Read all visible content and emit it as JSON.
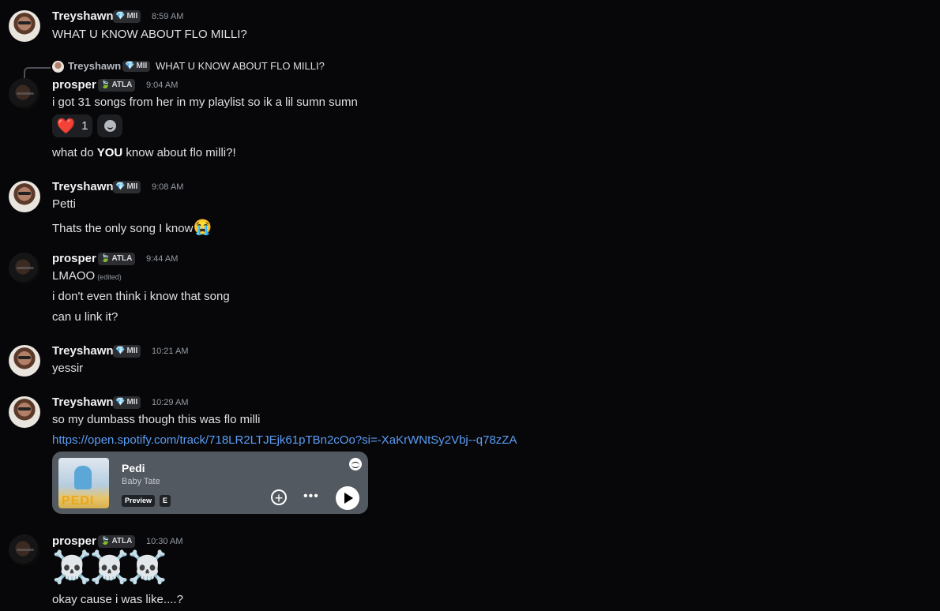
{
  "users": {
    "treyshawn": {
      "name": "Treyshawn",
      "badge": "MII",
      "badge_icon": "💎"
    },
    "prosper": {
      "name": "prosper",
      "badge": "ATLA",
      "badge_icon": "🍃"
    }
  },
  "messages": [
    {
      "author": "Treyshawn",
      "badge": "MII",
      "time": "8:59 AM",
      "lines": [
        "WHAT U KNOW ABOUT FLO MILLI?"
      ]
    },
    {
      "reply": {
        "author": "Treyshawn",
        "badge": "MII",
        "text": "WHAT U KNOW ABOUT FLO MILLI?"
      },
      "author": "prosper",
      "badge": "ATLA",
      "time": "9:04 AM",
      "lines": [
        "i got 31 songs from her in my playlist so ik a lil sumn sumn"
      ],
      "reaction": {
        "emoji": "❤️",
        "count": "1"
      },
      "line2_pre": "what do ",
      "line2_bold": "YOU",
      "line2_post": " know about flo milli?!"
    },
    {
      "author": "Treyshawn",
      "badge": "MII",
      "time": "9:08 AM",
      "lines": [
        "Petti",
        "Thats the only song I know"
      ],
      "emoji": "😭"
    },
    {
      "author": "prosper",
      "badge": "ATLA",
      "time": "9:44 AM",
      "lines": [
        "LMAOO",
        "i don't even think i know that song",
        "can u link it?"
      ],
      "edited": "(edited)"
    },
    {
      "author": "Treyshawn",
      "badge": "MII",
      "time": "10:21 AM",
      "lines": [
        "yessir"
      ]
    },
    {
      "author": "Treyshawn",
      "badge": "MII",
      "time": "10:29 AM",
      "lines": [
        "so my dumbass though this was flo milli"
      ],
      "link": "https://open.spotify.com/track/718LR2LTJEjk61pTBn2cOo?si=-XaKrWNtSy2Vbj--q78zZA",
      "embed": {
        "title": "Pedi",
        "artist": "Baby Tate",
        "chip_preview": "Preview",
        "chip_explicit": "E",
        "cover_text": "PEDI"
      }
    },
    {
      "author": "prosper",
      "badge": "ATLA",
      "time": "10:30 AM",
      "lines": [
        "☠️☠️☠️",
        "okay cause i was like....?"
      ]
    }
  ],
  "colors": {
    "background": "#070709",
    "link": "#5b9df5",
    "heart": "#e0262a",
    "embed_bg": "#535960"
  }
}
